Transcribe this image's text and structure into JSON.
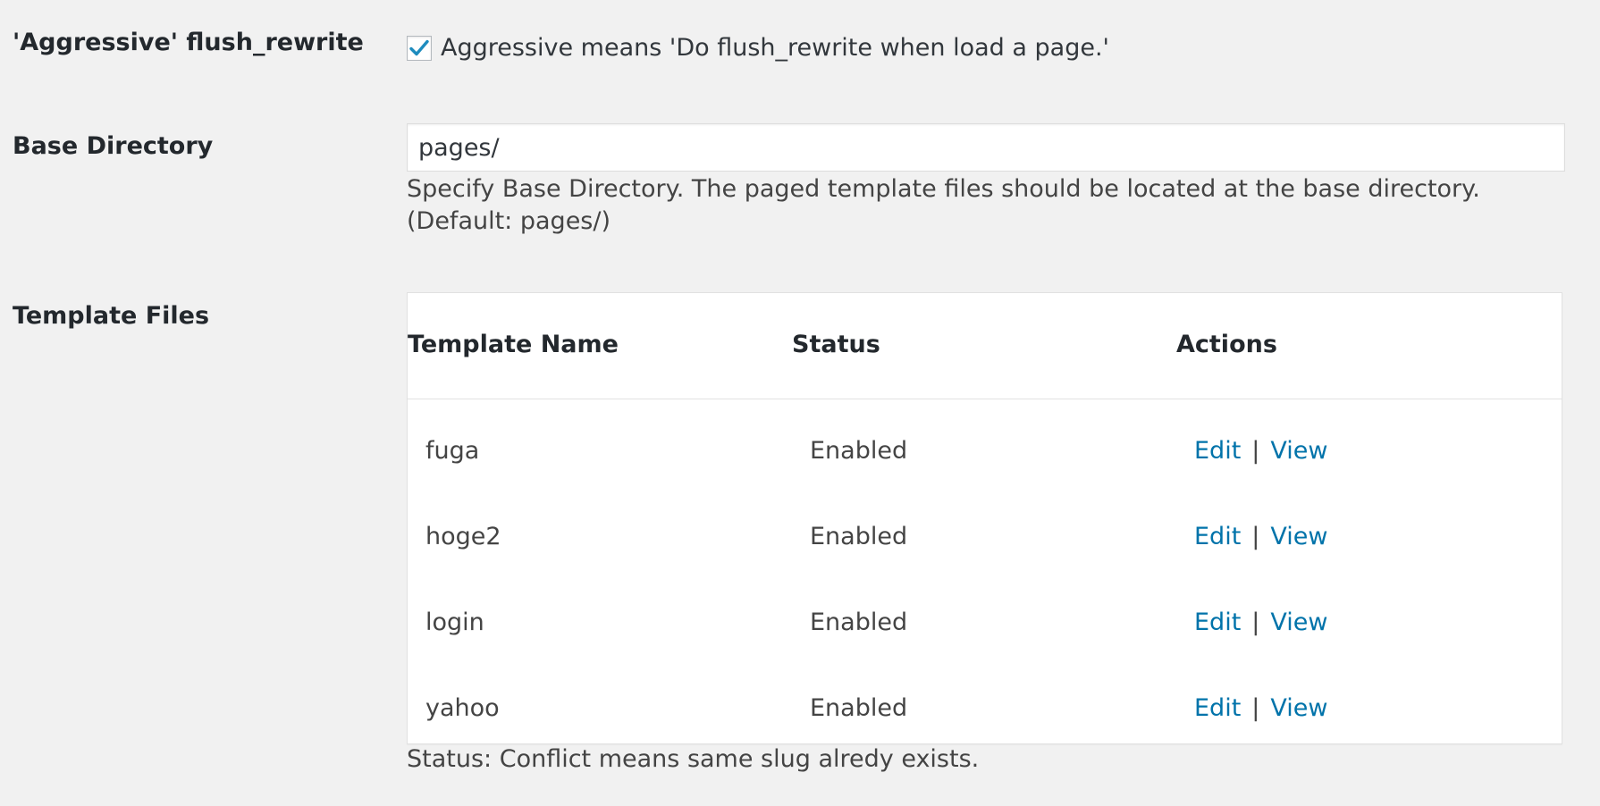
{
  "settings": {
    "aggressive": {
      "label": "'Aggressive' flush_rewrite",
      "checked": true,
      "checkbox_text": "Aggressive means 'Do flush_rewrite when load a page.'"
    },
    "base_directory": {
      "label": "Base Directory",
      "value": "pages/",
      "description": "Specify Base Directory. The paged template files should be located at the base directory. (Default: pages/)"
    },
    "template_files": {
      "label": "Template Files",
      "columns": [
        "Template Name",
        "Status",
        "Actions"
      ],
      "rows": [
        {
          "name": "fuga",
          "status": "Enabled",
          "edit": "Edit",
          "sep": "|",
          "view": "View"
        },
        {
          "name": "hoge2",
          "status": "Enabled",
          "edit": "Edit",
          "sep": "|",
          "view": "View"
        },
        {
          "name": "login",
          "status": "Enabled",
          "edit": "Edit",
          "sep": "|",
          "view": "View"
        },
        {
          "name": "yahoo",
          "status": "Enabled",
          "edit": "Edit",
          "sep": "|",
          "view": "View"
        }
      ],
      "note": "Status: Conflict means same slug alredy exists."
    }
  },
  "colors": {
    "link": "#0073aa",
    "checkmark": "#1e8cbe",
    "background": "#f1f1f1"
  },
  "icons": {
    "checkbox_check": "checkmark-icon"
  }
}
